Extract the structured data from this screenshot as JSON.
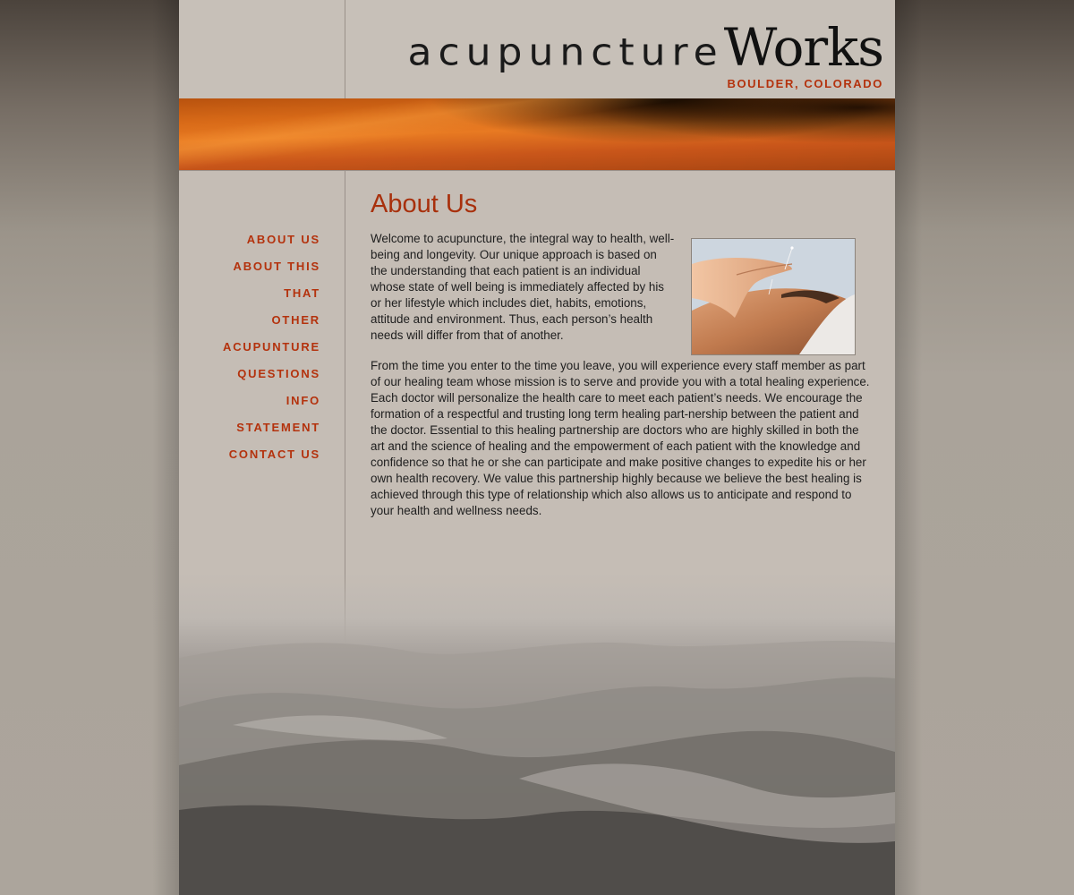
{
  "site": {
    "logo_light": "acupuncture",
    "logo_bold": "Works",
    "tagline": "BOULDER, COLORADO"
  },
  "nav": {
    "items": [
      {
        "label": "ABOUT US"
      },
      {
        "label": "ABOUT THIS"
      },
      {
        "label": "THAT"
      },
      {
        "label": "OTHER"
      },
      {
        "label": "ACUPUNTURE"
      },
      {
        "label": "QUESTIONS"
      },
      {
        "label": "INFO"
      },
      {
        "label": "STATEMENT"
      },
      {
        "label": "CONTACT US"
      }
    ]
  },
  "main": {
    "title": "About Us",
    "paragraph1": "Welcome to acupuncture, the integral way to health, well-being and longevity. Our unique approach is based on the understanding that each patient is an individual whose state of well being is immediately affected by his or her lifestyle which includes diet, habits, emotions, attitude and environment. Thus, each person’s health needs will differ from that of another.",
    "paragraph2": "From the time you enter to the time you leave, you will experience every staff member as part of our healing team whose mission is to serve and provide you with a total healing experience. Each doctor will personalize the health care to meet each patient’s needs. We encourage the formation of a respectful and trusting long term healing part-nership between the patient and the doctor. Essential to this healing partnership are doctors who are highly skilled in both the art and the science of healing and the empowerment of each patient with the knowledge and confidence so that he or she can participate and make positive changes to expedite his or her own health recovery. We value this partnership highly because we believe the best healing is achieved through this type of relationship which also allows us to anticipate and respond to your health and wellness needs."
  },
  "colors": {
    "accent": "#b4320d",
    "page_bg": "#c5bdb5",
    "text": "#1e1e1e"
  }
}
